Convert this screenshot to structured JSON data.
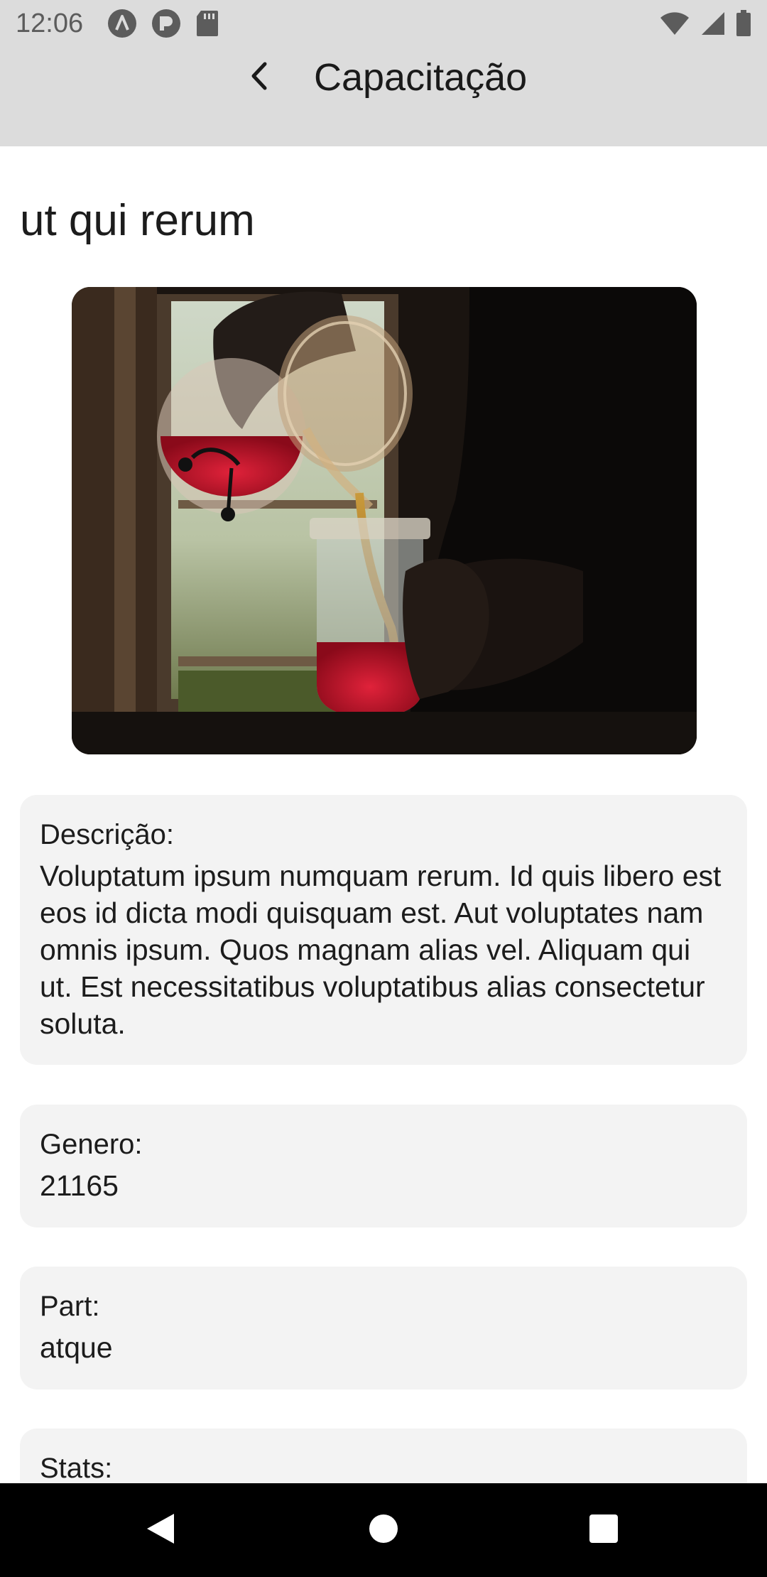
{
  "status_bar": {
    "time": "12:06",
    "left_icons": [
      "app-a-icon",
      "app-p-icon",
      "sd-card-icon"
    ],
    "right_icons": [
      "wifi-icon",
      "signal-icon",
      "battery-icon"
    ]
  },
  "app_bar": {
    "title": "Capacitação",
    "back_icon": "chevron-left-icon"
  },
  "item": {
    "title": "ut qui rerum",
    "image_description": "tea-pouring-photo"
  },
  "fields": {
    "descricao": {
      "label": "Descrição:",
      "value": "Voluptatum ipsum numquam rerum. Id quis libero est eos id dicta modi quisquam est. Aut voluptates nam omnis ipsum. Quos magnam alias vel. Aliquam qui ut. Est necessitatibus voluptatibus alias consectetur soluta."
    },
    "genero": {
      "label": "Genero:",
      "value": "21165"
    },
    "part": {
      "label": "Part:",
      "value": "atque"
    },
    "stats": {
      "label": "Stats:",
      "value": ""
    }
  },
  "nav_bar": {
    "buttons": [
      "back-triangle-icon",
      "home-circle-icon",
      "recents-square-icon"
    ]
  },
  "colors": {
    "app_bar_bg": "#dcdcdc",
    "card_bg": "#f3f3f3",
    "nav_bar_bg": "#000000"
  }
}
